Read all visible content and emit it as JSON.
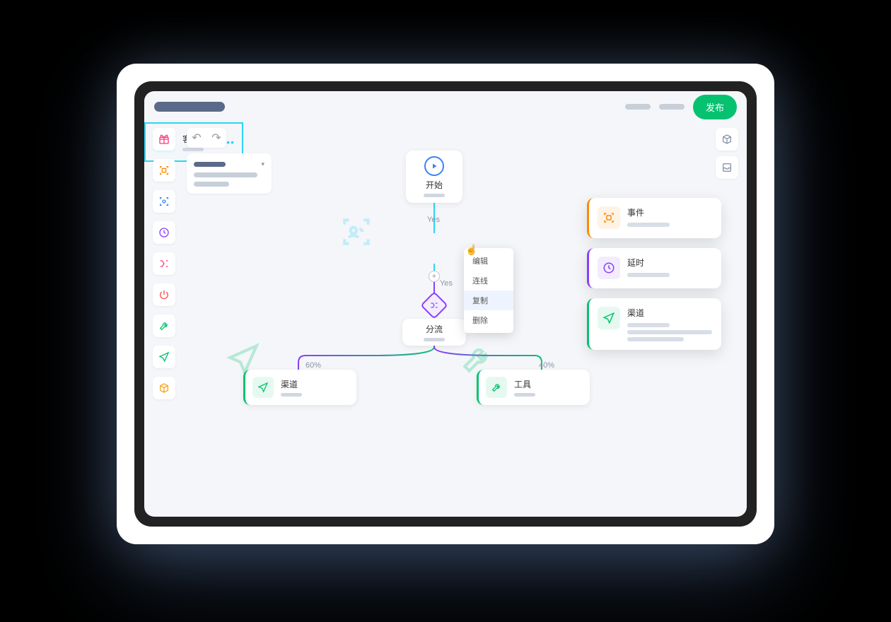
{
  "header": {
    "publish_label": "发布"
  },
  "sidebar_icons": [
    "gift",
    "scan-orange",
    "scan-blue",
    "clock",
    "split",
    "power",
    "wrench",
    "send",
    "cube"
  ],
  "right_icons": [
    "cube",
    "inbox"
  ],
  "nodes": {
    "start": {
      "title": "开始"
    },
    "crowd": {
      "title": "客群"
    },
    "split": {
      "title": "分流"
    },
    "channel": {
      "title": "渠道"
    },
    "tool": {
      "title": "工具"
    }
  },
  "edge_labels": {
    "yes1": "Yes",
    "yes2": "Yes",
    "left": "60%",
    "right": "40%"
  },
  "context_menu": {
    "items": [
      "编辑",
      "连线",
      "复制",
      "删除"
    ],
    "highlighted_index": 2
  },
  "float_cards": [
    {
      "title": "事件",
      "color": "#ff8a00",
      "icon": "scan"
    },
    {
      "title": "延时",
      "color": "#8a3ffc",
      "icon": "clock"
    },
    {
      "title": "渠道",
      "color": "#06c270",
      "icon": "send",
      "extra_lines": 3
    }
  ]
}
